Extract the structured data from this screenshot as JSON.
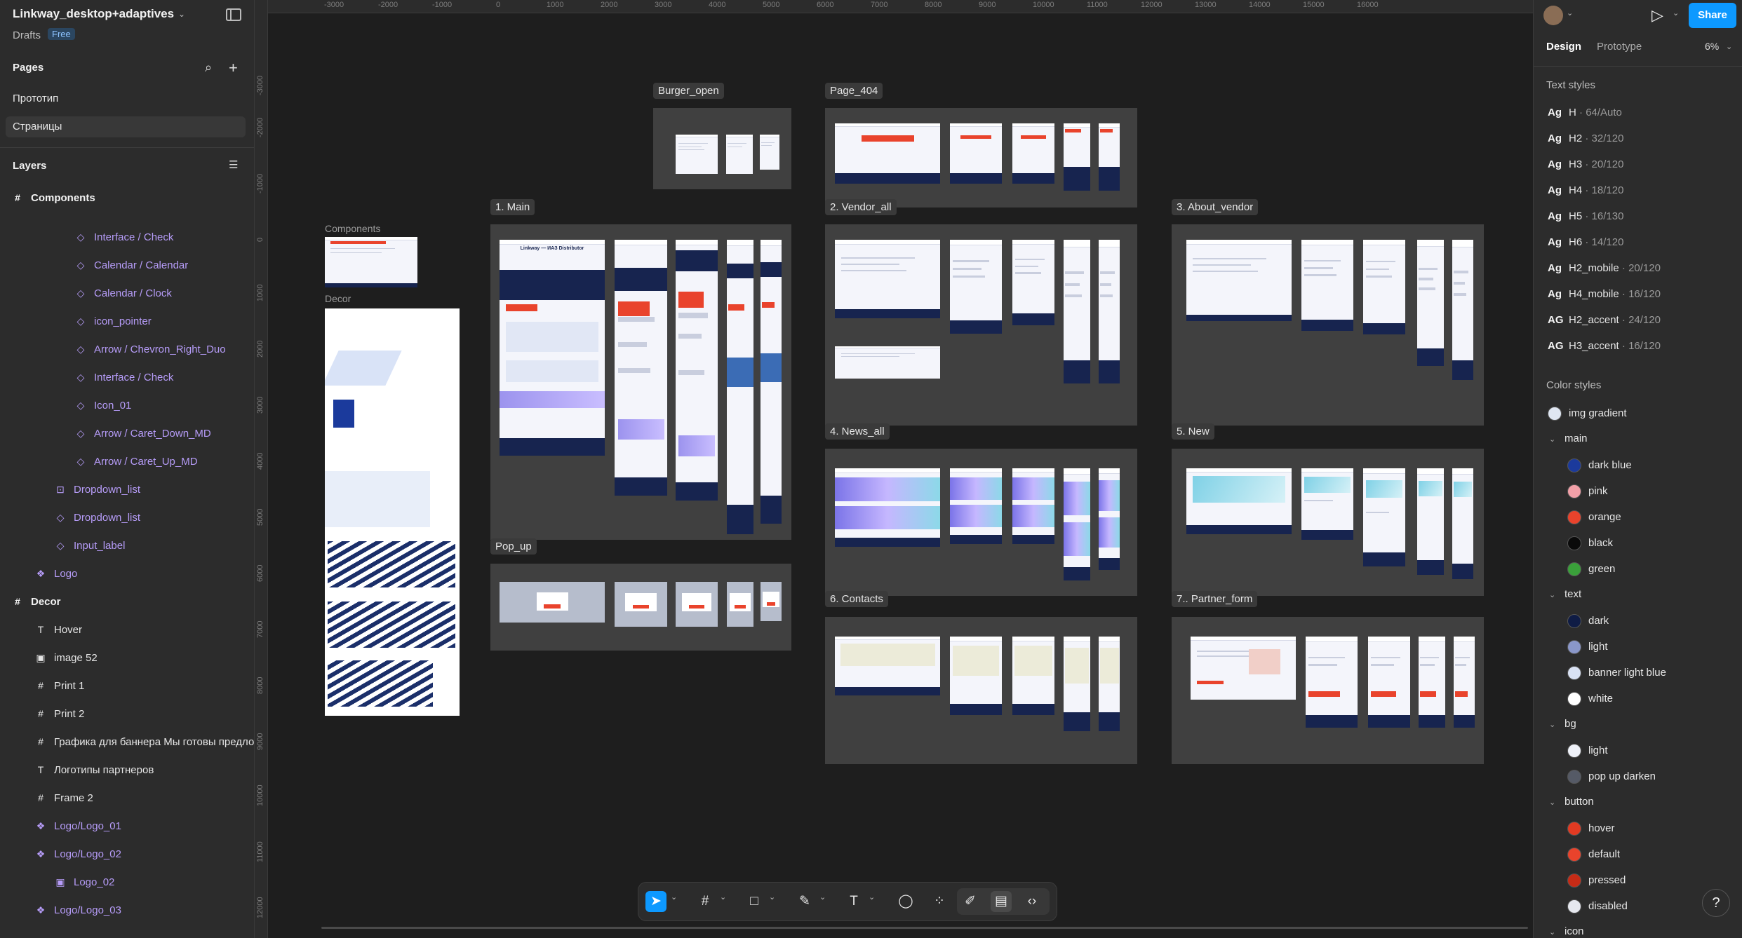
{
  "file": {
    "title": "Linkway_desktop+adaptives",
    "location": "Drafts",
    "plan": "Free"
  },
  "pages": {
    "header": "Pages",
    "items": [
      "Прототип",
      "Страницы"
    ],
    "selected": "Страницы"
  },
  "layers": {
    "header": "Layers",
    "items": [
      {
        "name": "Components",
        "kind": "frame"
      },
      {
        "name": "Interface / Check",
        "kind": "instance"
      },
      {
        "name": "Calendar / Calendar",
        "kind": "instance"
      },
      {
        "name": "Calendar / Clock",
        "kind": "instance"
      },
      {
        "name": "icon_pointer",
        "kind": "instance"
      },
      {
        "name": "Arrow / Chevron_Right_Duo",
        "kind": "instance"
      },
      {
        "name": "Interface / Check",
        "kind": "instance"
      },
      {
        "name": "Icon_01",
        "kind": "instance"
      },
      {
        "name": "Arrow / Caret_Down_MD",
        "kind": "instance"
      },
      {
        "name": "Arrow / Caret_Up_MD",
        "kind": "instance"
      },
      {
        "name": "Dropdown_list",
        "kind": "variants"
      },
      {
        "name": "Dropdown_list",
        "kind": "instance"
      },
      {
        "name": "Input_label",
        "kind": "instance"
      },
      {
        "name": "Logo",
        "kind": "component"
      },
      {
        "name": "Decor",
        "kind": "frame"
      },
      {
        "name": "Hover",
        "kind": "text"
      },
      {
        "name": "image 52",
        "kind": "image"
      },
      {
        "name": "Print 1",
        "kind": "frame"
      },
      {
        "name": "Print 2",
        "kind": "frame"
      },
      {
        "name": "Графика для баннера Мы готовы предлож",
        "kind": "frame"
      },
      {
        "name": "Логотипы партнеров",
        "kind": "text"
      },
      {
        "name": "Frame 2",
        "kind": "frame"
      },
      {
        "name": "Logo/Logo_01",
        "kind": "component"
      },
      {
        "name": "Logo/Logo_02",
        "kind": "component"
      },
      {
        "name": "Logo_02",
        "kind": "image"
      },
      {
        "name": "Logo/Logo_03",
        "kind": "component"
      }
    ]
  },
  "canvas": {
    "ruler_x": [
      "-3000",
      "-2000",
      "-1000",
      "0",
      "1000",
      "2000",
      "3000",
      "4000",
      "5000",
      "6000",
      "7000",
      "8000",
      "9000",
      "10000",
      "11000",
      "12000",
      "13000",
      "14000",
      "15000",
      "16000"
    ],
    "ruler_y": [
      "-3000",
      "-2000",
      "-1000",
      "0",
      "1000",
      "2000",
      "3000",
      "4000",
      "5000",
      "6000",
      "7000",
      "8000",
      "9000",
      "10000",
      "11000",
      "12000"
    ],
    "frames": {
      "components": "Components",
      "decor": "Decor",
      "burger_open": "Burger_open",
      "page_404": "Page_404",
      "main": "1. Main",
      "vendor_all": "2. Vendor_all",
      "about_vendor": "3. About_vendor",
      "news_all": "4. News_all",
      "new": "5. New",
      "pop_up": "Pop_up",
      "contacts": "6. Contacts",
      "partner_form": "7.. Partner_form"
    },
    "hero_text": "Linkway — ИАЗ Distributor"
  },
  "toolbar": {
    "tools": [
      "move-tool",
      "frame-tool",
      "shape-tool",
      "pen-tool",
      "text-tool",
      "comment-tool",
      "actions-tool",
      "draw-mode",
      "design-mode",
      "dev-mode"
    ],
    "active": "move-tool"
  },
  "right_panel": {
    "share_label": "Share",
    "tabs": [
      "Design",
      "Prototype"
    ],
    "zoom": "6%",
    "text_styles_header": "Text styles",
    "text_styles": [
      {
        "ag": "Ag",
        "name": "H",
        "spec": "64/Auto"
      },
      {
        "ag": "Ag",
        "name": "H2",
        "spec": "32/120"
      },
      {
        "ag": "Ag",
        "name": "H3",
        "spec": "20/120"
      },
      {
        "ag": "Ag",
        "name": "H4",
        "spec": "18/120"
      },
      {
        "ag": "Ag",
        "name": "H5",
        "spec": "16/130"
      },
      {
        "ag": "Ag",
        "name": "H6",
        "spec": "14/120"
      },
      {
        "ag": "Ag",
        "name": "H2_mobile",
        "spec": "20/120"
      },
      {
        "ag": "Ag",
        "name": "H4_mobile",
        "spec": "16/120"
      },
      {
        "ag": "AG",
        "name": "H2_accent",
        "spec": "24/120"
      },
      {
        "ag": "AG",
        "name": "H3_accent",
        "spec": "16/120"
      }
    ],
    "color_styles_header": "Color styles",
    "img_gradient": {
      "name": "img gradient",
      "color": "#dfe6f2"
    },
    "groups": [
      {
        "name": "main",
        "colors": [
          {
            "name": "dark blue",
            "color": "#1b3a9c"
          },
          {
            "name": "pink",
            "color": "#f2a0a8"
          },
          {
            "name": "orange",
            "color": "#e9432c"
          },
          {
            "name": "black",
            "color": "#0a0a0a"
          },
          {
            "name": "green",
            "color": "#3aa03a"
          }
        ]
      },
      {
        "name": "text",
        "colors": [
          {
            "name": "dark",
            "color": "#0f1c45"
          },
          {
            "name": "light",
            "color": "#8a97c9"
          },
          {
            "name": "banner light blue",
            "color": "#d9e2f4"
          },
          {
            "name": "white",
            "color": "#ffffff"
          }
        ]
      },
      {
        "name": "bg",
        "colors": [
          {
            "name": "light",
            "color": "#eef1f8"
          },
          {
            "name": "pop up darken",
            "color": "#555a66"
          }
        ]
      },
      {
        "name": "button",
        "colors": [
          {
            "name": "hover",
            "color": "#e23a22"
          },
          {
            "name": "default",
            "color": "#e9432c"
          },
          {
            "name": "pressed",
            "color": "#c72b16"
          },
          {
            "name": "disabled",
            "color": "#e6e8ef"
          }
        ]
      },
      {
        "name": "icon",
        "colors": []
      }
    ]
  }
}
